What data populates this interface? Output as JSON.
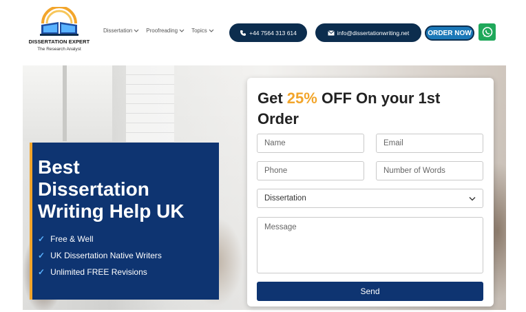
{
  "brand": {
    "name": "DISSERTATION EXPERT",
    "tagline": "The Research Analyst"
  },
  "nav": [
    {
      "label": "Dissertation"
    },
    {
      "label": "Proofreading"
    },
    {
      "label": "Topics"
    }
  ],
  "contact": {
    "phone": "+44 7564 313 614",
    "email": "info@dissertationwriting.net",
    "order_label": "ORDER NOW"
  },
  "hero": {
    "title_lines": [
      "Best",
      "Dissertation",
      "Writing Help UK"
    ],
    "features": [
      "Free & Well",
      "UK Dissertation Native Writers",
      "Unlimited FREE Revisions"
    ]
  },
  "form": {
    "title_prefix": "Get ",
    "title_highlight": "25%",
    "title_suffix": " OFF On your 1st Order",
    "name_placeholder": "Name",
    "email_placeholder": "Email",
    "phone_placeholder": "Phone",
    "words_placeholder": "Number of Words",
    "select_value": "Dissertation",
    "message_placeholder": "Message",
    "send_label": "Send"
  },
  "colors": {
    "navy": "#0e3471",
    "accent": "#f2a52b",
    "pill": "#0c2d4e",
    "whatsapp": "#1fa85a"
  },
  "icons": [
    "open-book-logo-icon",
    "chevron-down-icon",
    "phone-icon",
    "mail-icon",
    "whatsapp-icon",
    "checkmark-icon"
  ]
}
